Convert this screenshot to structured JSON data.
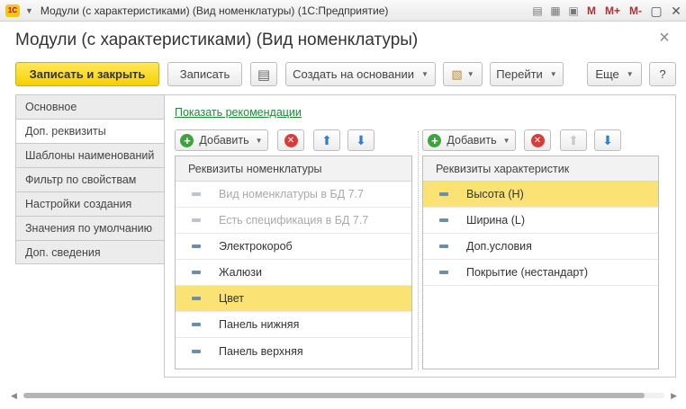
{
  "window": {
    "title": "Модули (с характеристиками) (Вид номенклатуры)  (1С:Предприятие)",
    "logo_text": "1С",
    "m_buttons": [
      "M",
      "M+",
      "M-"
    ]
  },
  "form": {
    "title": "Модули (с характеристиками) (Вид номенклатуры)",
    "close_glyph": "×"
  },
  "toolbar": {
    "save_close": "Записать и закрыть",
    "save": "Записать",
    "create_based": "Создать на основании",
    "goto": "Перейти",
    "more": "Еще",
    "help": "?"
  },
  "tabs": [
    {
      "label": "Основное",
      "active": false
    },
    {
      "label": "Доп. реквизиты",
      "active": true
    },
    {
      "label": "Шаблоны наименований",
      "active": false
    },
    {
      "label": "Фильтр по свойствам",
      "active": false
    },
    {
      "label": "Настройки создания",
      "active": false
    },
    {
      "label": "Значения по умолчанию",
      "active": false
    },
    {
      "label": "Доп. сведения",
      "active": false
    }
  ],
  "main": {
    "show_recs_link": "Показать рекомендации",
    "left": {
      "add_label": "Добавить",
      "header": "Реквизиты номенклатуры",
      "rows": [
        {
          "label": "Вид номенклатуры в БД 7.7",
          "dim": true,
          "selected": false
        },
        {
          "label": "Есть спецификация в БД 7.7",
          "dim": true,
          "selected": false
        },
        {
          "label": "Электрокороб",
          "dim": false,
          "selected": false
        },
        {
          "label": "Жалюзи",
          "dim": false,
          "selected": false
        },
        {
          "label": "Цвет",
          "dim": false,
          "selected": true
        },
        {
          "label": "Панель нижняя",
          "dim": false,
          "selected": false
        },
        {
          "label": "Панель верхняя",
          "dim": false,
          "selected": false
        }
      ]
    },
    "right": {
      "add_label": "Добавить",
      "header": "Реквизиты характеристик",
      "rows": [
        {
          "label": "Высота (Н)",
          "dim": false,
          "selected": true
        },
        {
          "label": "Ширина (L)",
          "dim": false,
          "selected": false
        },
        {
          "label": "Доп.условия",
          "dim": false,
          "selected": false
        },
        {
          "label": "Покрытие (нестандарт)",
          "dim": false,
          "selected": false
        }
      ]
    }
  },
  "colors": {
    "accent_yellow": "#f5d000",
    "selection": "#fbe274",
    "link_green": "#1e8a3c",
    "add_green": "#3ea33e",
    "delete_red": "#d93b3b",
    "arrow_blue": "#2f7fd1"
  },
  "icons": {
    "add": "plus-circle-icon",
    "delete": "delete-circle-icon",
    "up": "arrow-up-icon",
    "down": "arrow-down-icon",
    "list": "list-icon",
    "report": "report-icon",
    "row": "attribute-icon"
  }
}
